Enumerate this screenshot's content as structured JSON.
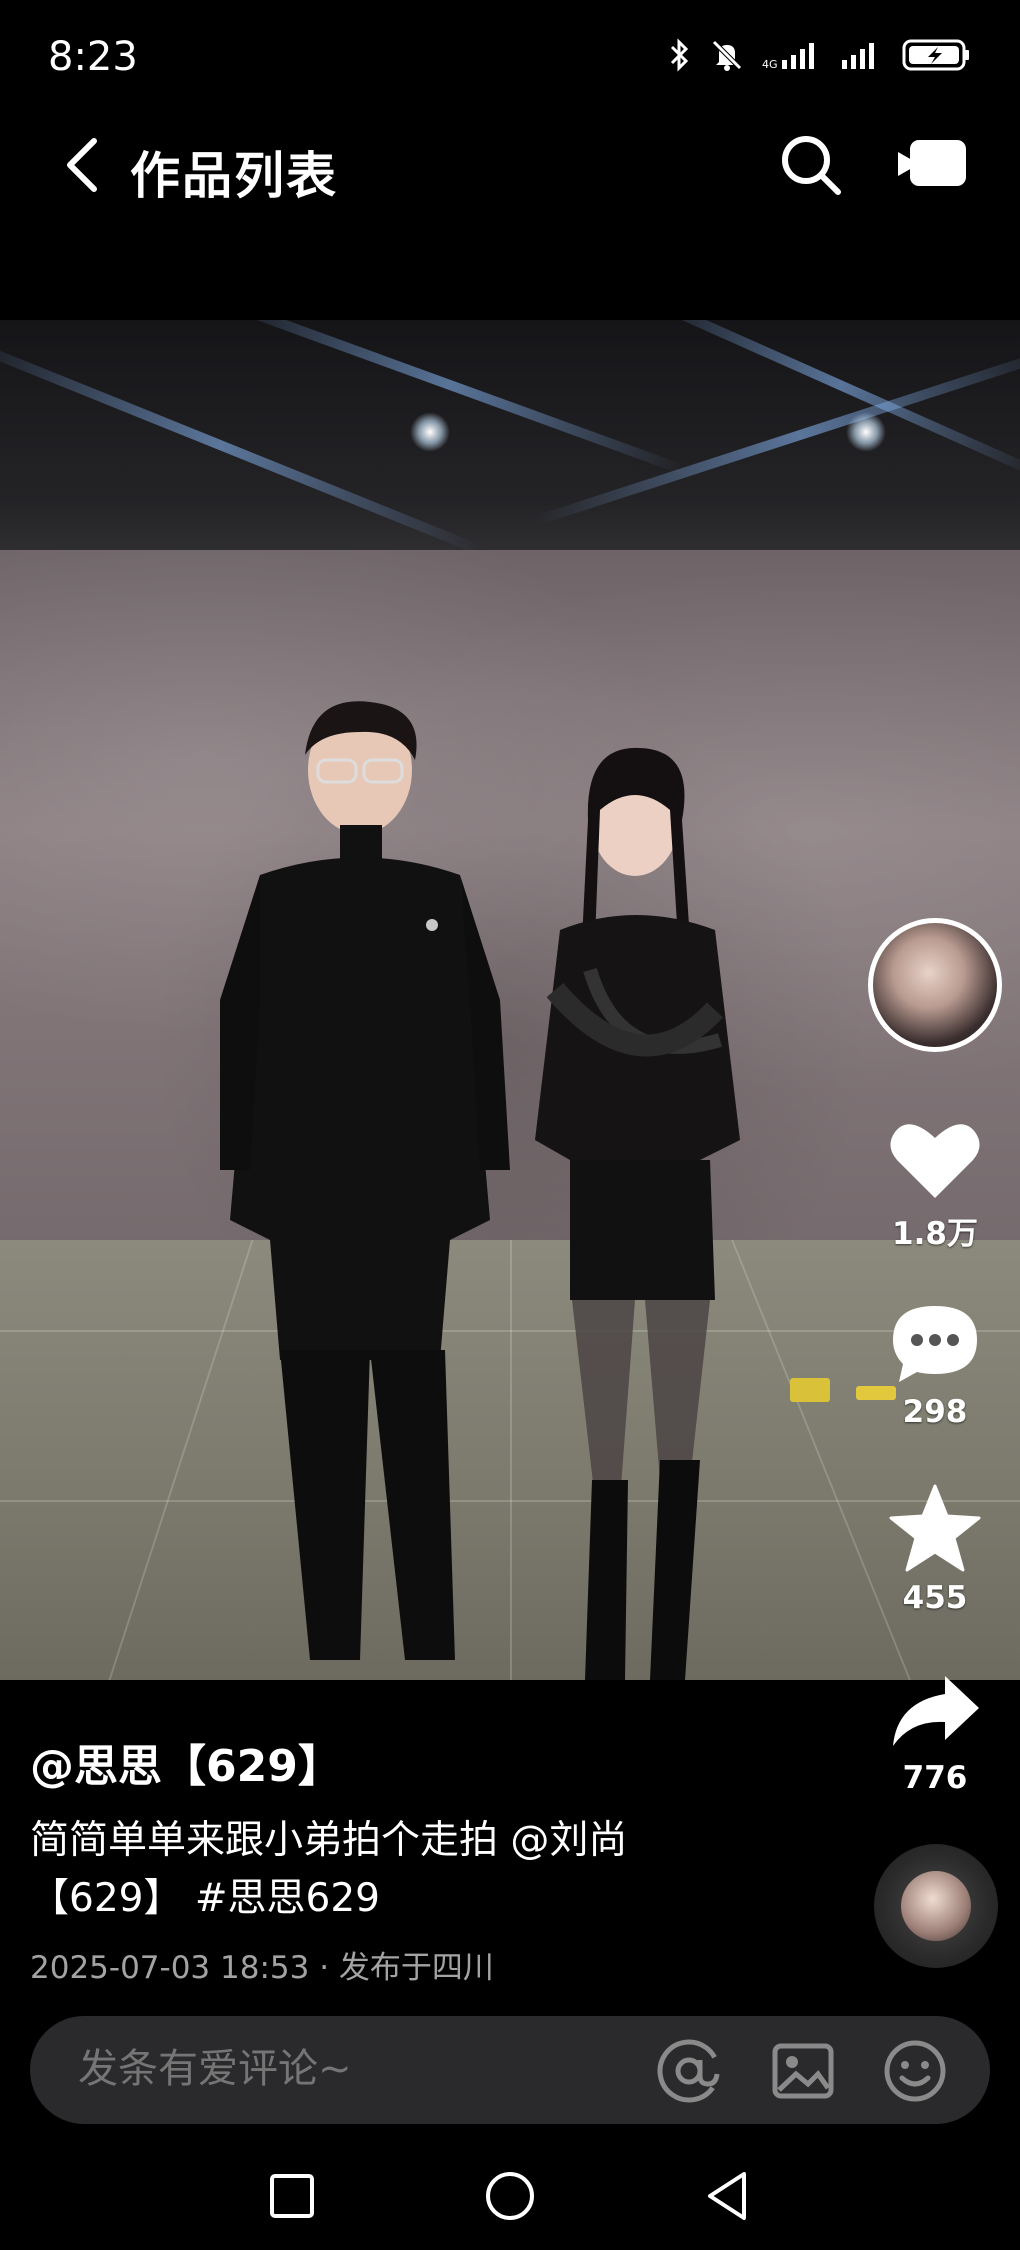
{
  "status_bar": {
    "time": "8:23",
    "icons": [
      "bluetooth-icon",
      "mute-icon",
      "signal-icon",
      "signal-icon",
      "battery-charging-icon"
    ]
  },
  "header": {
    "title": "作品列表",
    "back_icon": "chevron-left-icon",
    "search_icon": "search-icon",
    "video_icon": "video-camera-icon"
  },
  "actions": {
    "likes": "1.8万",
    "comments": "298",
    "favorites": "455",
    "shares": "776"
  },
  "post": {
    "author": "@思思【629】",
    "description": "简简单单来跟小弟拍个走拍 @刘尚【629】 #思思629",
    "desc_parts": {
      "text": "简简单单来跟小弟拍个走拍 ",
      "mention": "@刘尚【629】",
      "hashtag": " #思思629"
    },
    "datetime": "2025-07-03 18:53",
    "location": "· 发布于四川"
  },
  "comment_bar": {
    "placeholder": "发条有爱评论~"
  },
  "nav_bar": {
    "buttons": [
      "recent-apps",
      "home",
      "back"
    ]
  },
  "colors": {
    "background": "#000000",
    "comment_bar_bg": "#2a2a2c",
    "meta_text": "#a3a3a3"
  }
}
